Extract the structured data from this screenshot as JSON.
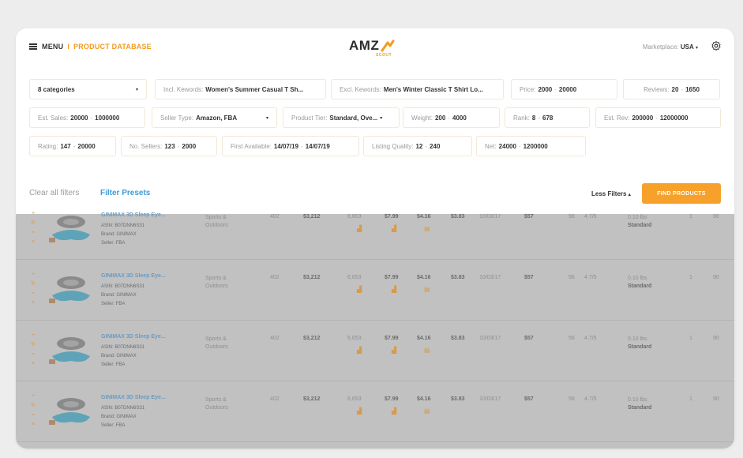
{
  "header": {
    "menu_label": "MENU",
    "separator": "I",
    "breadcrumb": "PRODUCT DATABASE",
    "logo_main": "AMZ",
    "logo_sub": "SCOUT",
    "marketplace_label": "Marketplace:",
    "marketplace_value": "USA",
    "marketplace_caret": "▾"
  },
  "filters": {
    "categories": "8 categories",
    "incl_label": "Incl. Kewords:",
    "incl_value": "Women's Summer Casual T Sh...",
    "excl_label": "Excl. Kewords:",
    "excl_value": "Men's Winter Classic T Shirt Lo...",
    "price_label": "Price:",
    "price_min": "2000",
    "price_max": "20000",
    "reviews_label": "Reviews:",
    "reviews_min": "20",
    "reviews_max": "1650",
    "sales_label": "Est. Sales:",
    "sales_min": "20000",
    "sales_max": "1000000",
    "seller_label": "Seller Type:",
    "seller_value": "Amazon, FBA",
    "tier_label": "Product Tier:",
    "tier_value": "Standard, Ove...",
    "weight_label": "Weight:",
    "weight_min": "200",
    "weight_max": "4000",
    "rank_label": "Rank:",
    "rank_min": "8",
    "rank_max": "678",
    "rev_label": "Est. Rev:",
    "rev_min": "200000",
    "rev_max": "12000000",
    "rating_label": "Rating:",
    "rating_min": "147",
    "rating_max": "20000",
    "nsellers_label": "No. Sellers:",
    "nsellers_min": "123",
    "nsellers_max": "2000",
    "first_label": "First Available:",
    "first_min": "14/07/19",
    "first_max": "14/07/19",
    "lq_label": "Listing Quality:",
    "lq_min": "12",
    "lq_max": "240",
    "net_label": "Net:",
    "net_min": "24000",
    "net_max": "1200000",
    "dash": "-",
    "caret": "▾"
  },
  "actions": {
    "clear": "Clear all filters",
    "presets": "Filter Presets",
    "less": "Less Filters",
    "less_caret": "▴",
    "find": "FIND PRODUCTS"
  },
  "row_template": {
    "title": "GINIMAX 3D Sleep Eye...",
    "asin_label": "ASIN:",
    "asin": "B07DNN6S31",
    "brand_label": "Brand:",
    "brand": "GINIMAX",
    "seller_label": "Seller:",
    "seller": "FBA",
    "category_1": "Sports &",
    "category_2": "Outdoors",
    "rank": "402",
    "revenue": "$3,212",
    "sales": "6,653",
    "price": "$7.99",
    "fees": "$4.16",
    "net": "$3.83",
    "date": "10/03/17",
    "lq": "$57",
    "reviews": "56",
    "rating": "4.7/5",
    "weight": "0.10 lbs",
    "tier": "Standard",
    "sellers": "1",
    "score": "90"
  },
  "colors": {
    "accent": "#f29c1f",
    "link": "#3d9bd8",
    "button": "#f7a12b"
  }
}
